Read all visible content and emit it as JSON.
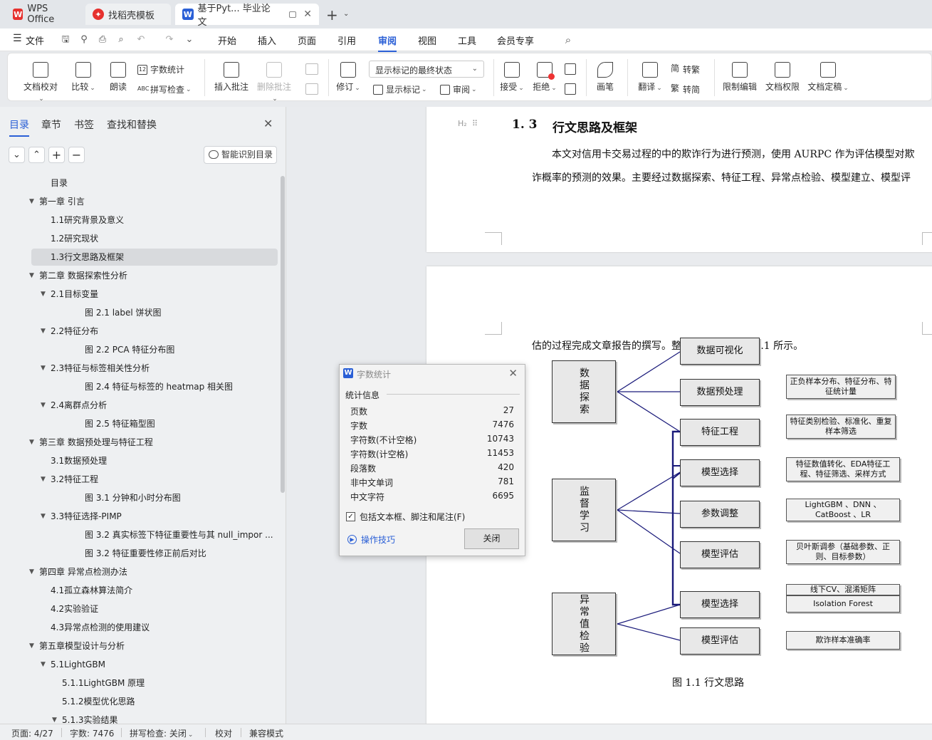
{
  "tabs": [
    {
      "label": "WPS Office",
      "icon": "wps-logo-icon",
      "color": "#e6312e"
    },
    {
      "label": "找稻壳模板",
      "icon": "docer-logo-icon",
      "color": "#e6312e"
    },
    {
      "label": "基于Pyt... 毕业论文",
      "icon": "writer-logo-icon",
      "color": "#2a5fd6"
    }
  ],
  "menubar": {
    "file": "文件",
    "items": [
      "开始",
      "插入",
      "页面",
      "引用",
      "审阅",
      "视图",
      "工具",
      "会员专享"
    ],
    "active": "审阅"
  },
  "ribbon": {
    "doc_check": "文档校对",
    "compare": "比较",
    "read_aloud": "朗读",
    "word_count": "字数统计",
    "spell_check": "拼写检查",
    "insert_comment": "插入批注",
    "delete_comment": "删除批注",
    "track_changes": "修订",
    "markup_state": "显示标记的最终状态",
    "show_markup": "显示标记",
    "review": "审阅",
    "accept": "接受",
    "reject": "拒绝",
    "pen": "画笔",
    "translate": "翻译",
    "to_traditional": "转繁",
    "to_simplified": "转简",
    "restrict_edit": "限制编辑",
    "doc_permission": "文档权限",
    "doc_finalize": "文档定稿"
  },
  "nav": {
    "tabs": [
      "目录",
      "章节",
      "书签",
      "查找和替换"
    ],
    "smart_toc": "智能识别目录",
    "toc": [
      {
        "text": "目录",
        "level": 1,
        "arrow": false
      },
      {
        "text": "第一章 引言",
        "level": 0,
        "arrow": true
      },
      {
        "text": "1.1研究背景及意义",
        "level": 1,
        "arrow": false
      },
      {
        "text": "1.2研究现状",
        "level": 1,
        "arrow": false
      },
      {
        "text": "1.3行文思路及框架",
        "level": 1,
        "arrow": false,
        "selected": true
      },
      {
        "text": "第二章 数据探索性分析",
        "level": 0,
        "arrow": true
      },
      {
        "text": "2.1目标变量",
        "level": 1,
        "arrow": true
      },
      {
        "text": "图 2.1 label 饼状图",
        "level": 3,
        "arrow": false
      },
      {
        "text": "2.2特征分布",
        "level": 1,
        "arrow": true
      },
      {
        "text": "图 2.2 PCA 特征分布图",
        "level": 3,
        "arrow": false
      },
      {
        "text": "2.3特征与标签相关性分析",
        "level": 1,
        "arrow": true
      },
      {
        "text": "图 2.4 特征与标签的 heatmap 相关图",
        "level": 3,
        "arrow": false
      },
      {
        "text": "2.4离群点分析",
        "level": 1,
        "arrow": true
      },
      {
        "text": "图 2.5 特征箱型图",
        "level": 3,
        "arrow": false
      },
      {
        "text": "第三章 数据预处理与特征工程",
        "level": 0,
        "arrow": true
      },
      {
        "text": "3.1数据预处理",
        "level": 1,
        "arrow": false
      },
      {
        "text": "3.2特征工程",
        "level": 1,
        "arrow": true
      },
      {
        "text": "图 3.1 分钟和小时分布图",
        "level": 3,
        "arrow": false
      },
      {
        "text": "3.3特征选择-PIMP",
        "level": 1,
        "arrow": true
      },
      {
        "text": "图 3.2  真实标签下特征重要性与其 null_impor ...",
        "level": 3,
        "arrow": false
      },
      {
        "text": "图 3.2 特征重要性修正前后对比",
        "level": 3,
        "arrow": false
      },
      {
        "text": "第四章 异常点检测办法",
        "level": 0,
        "arrow": true
      },
      {
        "text": "4.1孤立森林算法简介",
        "level": 1,
        "arrow": false
      },
      {
        "text": "4.2实验验证",
        "level": 1,
        "arrow": false
      },
      {
        "text": "4.3异常点检测的使用建议",
        "level": 1,
        "arrow": false
      },
      {
        "text": "第五章模型设计与分析",
        "level": 0,
        "arrow": true
      },
      {
        "text": "5.1LightGBM",
        "level": 1,
        "arrow": true
      },
      {
        "text": "5.1.1LightGBM 原理",
        "level": 2,
        "arrow": false
      },
      {
        "text": "5.1.2模型优化思路",
        "level": 2,
        "arrow": false
      },
      {
        "text": "5.1.3实验结果",
        "level": 2,
        "arrow": true
      }
    ]
  },
  "document": {
    "heading_marker": "H₂",
    "heading_num": "1. 3",
    "heading_text": "行文思路及框架",
    "para1_line1": "本文对信用卡交易过程的中的欺诈行为进行预测，使用 AURPC 作为评估模型对欺",
    "para1_line2": "诈概率的预测的效果。主要经过数据探索、特征工程、异常点检验、模型建立、模型评",
    "para2_line1": "估的过程完成文章报告的撰写。整体的框架如下图 1.1 所示。",
    "figure_caption": "图 1.1 行文思路",
    "diagram": {
      "groups": [
        "数据探索",
        "监督学习",
        "异常值检验"
      ],
      "steps": [
        "数据可视化",
        "数据预处理",
        "特征工程",
        "模型选择",
        "参数调整",
        "模型评估",
        "模型选择",
        "模型评估"
      ],
      "notes": [
        "正负样本分布、特征分布、特征统计量",
        "特征类别检验、标准化、重复样本筛选",
        "特征数值转化、EDA特征工程、特征筛选、采样方式",
        "LightGBM 、DNN 、CatBoost 、LR",
        "贝叶斯调参（基础参数、正则、目标参数）",
        "线下CV、混淆矩阵",
        "Isolation Forest",
        "欺诈样本准确率"
      ]
    }
  },
  "word_count_dialog": {
    "title": "字数统计",
    "section": "统计信息",
    "rows": [
      {
        "label": "页数",
        "value": "27"
      },
      {
        "label": "字数",
        "value": "7476"
      },
      {
        "label": "字符数(不计空格)",
        "value": "10743"
      },
      {
        "label": "字符数(计空格)",
        "value": "11453"
      },
      {
        "label": "段落数",
        "value": "420"
      },
      {
        "label": "非中文单词",
        "value": "781"
      },
      {
        "label": "中文字符",
        "value": "6695"
      }
    ],
    "checkbox_label": "包括文本框、脚注和尾注(F)",
    "checkbox_checked": true,
    "tips": "操作技巧",
    "close_button": "关闭"
  },
  "statusbar": {
    "page": "页面: 4/27",
    "words": "字数: 7476",
    "spell": "拼写检查: 关闭",
    "proof": "校对",
    "compat": "兼容模式"
  }
}
